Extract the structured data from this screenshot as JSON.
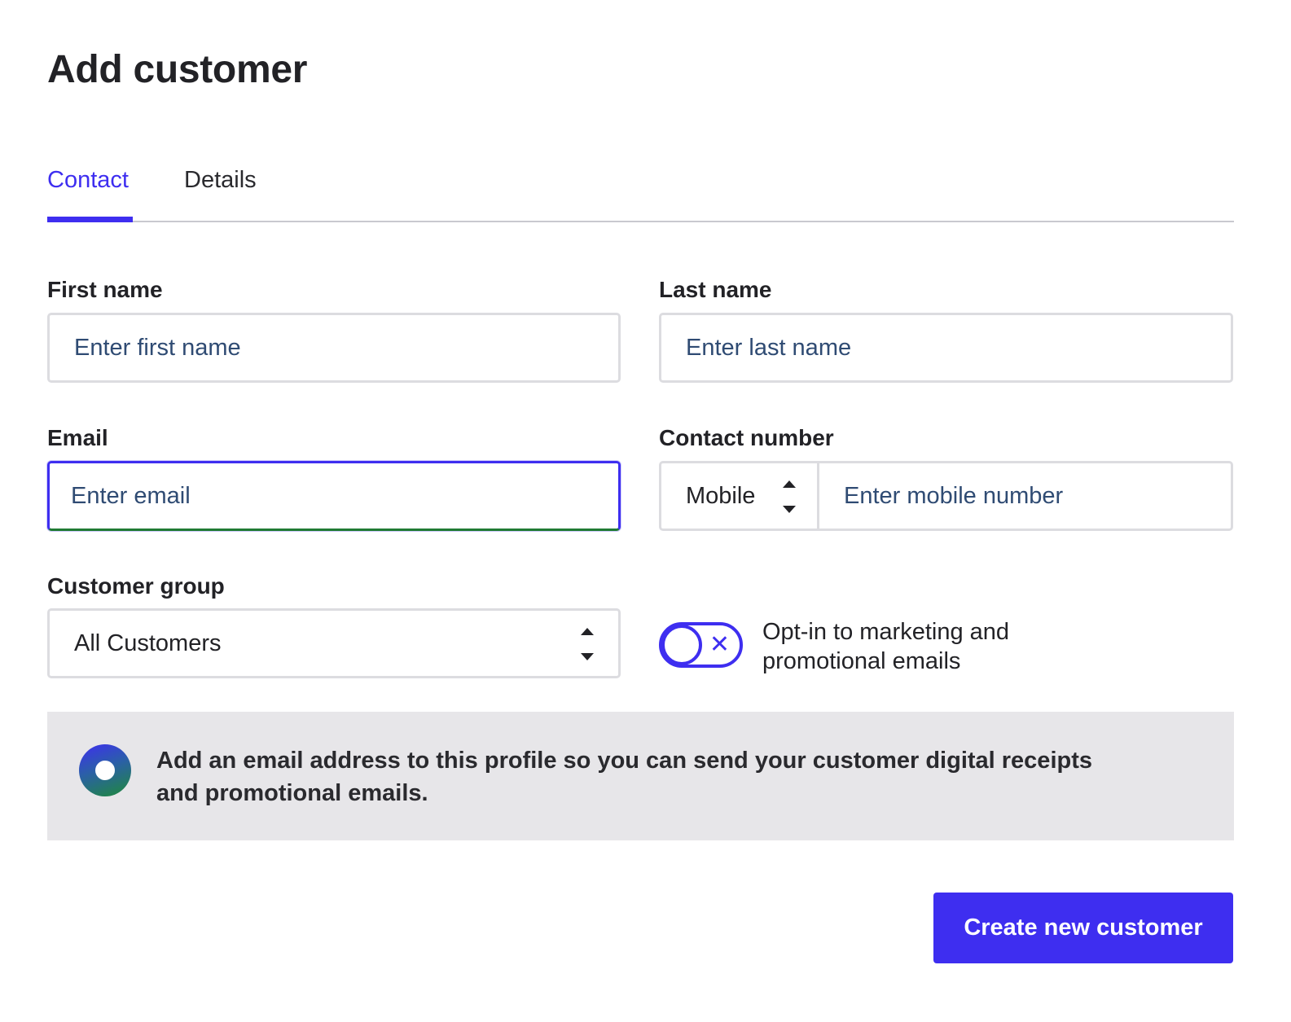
{
  "page": {
    "title": "Add customer"
  },
  "tabs": [
    {
      "label": "Contact",
      "active": true
    },
    {
      "label": "Details",
      "active": false
    }
  ],
  "form": {
    "first_name": {
      "label": "First name",
      "placeholder": "Enter first name",
      "value": ""
    },
    "last_name": {
      "label": "Last name",
      "placeholder": "Enter last name",
      "value": ""
    },
    "email": {
      "label": "Email",
      "placeholder": "Enter email",
      "value": "",
      "focused": true
    },
    "contact_number": {
      "label": "Contact number",
      "type_selected": "Mobile",
      "placeholder": "Enter mobile number",
      "value": ""
    },
    "customer_group": {
      "label": "Customer group",
      "selected": "All Customers"
    },
    "opt_in": {
      "label": "Opt-in to marketing and promotional emails",
      "checked": false,
      "icon": "close-icon"
    }
  },
  "banner": {
    "icon": "info-ring-icon",
    "text": "Add an email address to this profile so you can send your customer digital receipts and promotional emails."
  },
  "actions": {
    "create_label": "Create new customer"
  },
  "colors": {
    "accent": "#3e2ef0",
    "focus_bottom": "#1f7a33",
    "placeholder": "#2f4b73",
    "banner_bg": "#e7e6e9",
    "border": "#dcdce0"
  }
}
